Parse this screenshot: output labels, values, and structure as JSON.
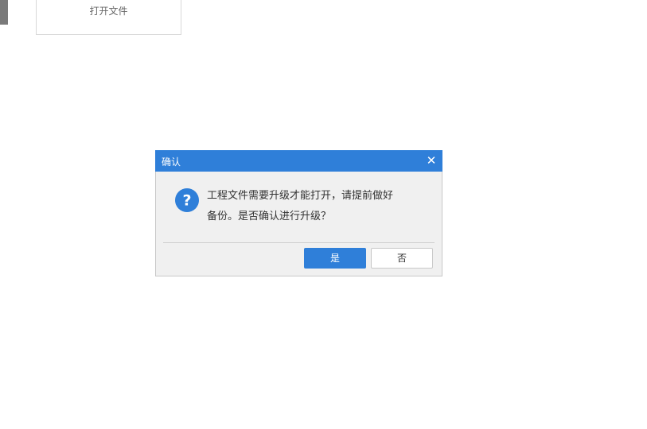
{
  "background_card": {
    "open_file_label": "打开文件"
  },
  "dialog": {
    "title": "确认",
    "close_icon": "close-icon",
    "question_icon": "question-icon",
    "message": "工程文件需要升级才能打开，请提前做好\n备份。是否确认进行升级？",
    "yes_label": "是",
    "no_label": "否"
  },
  "colors": {
    "accent": "#2f7fd9",
    "dialog_bg": "#f0f0f0",
    "text": "#333333"
  }
}
